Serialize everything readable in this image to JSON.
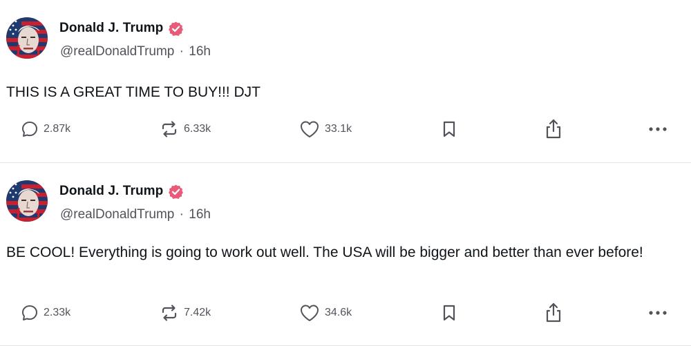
{
  "colors": {
    "verified_badge": "#e85a78",
    "text": "#0f1419",
    "muted": "#52525b",
    "divider": "#e6e6ea"
  },
  "posts": [
    {
      "author_name": "Donald J. Trump",
      "handle": "@realDonaldTrump",
      "separator": "·",
      "time": "16h",
      "text": "THIS IS A GREAT TIME TO BUY!!! DJT",
      "replies": "2.87k",
      "retruths": "6.33k",
      "likes": "33.1k"
    },
    {
      "author_name": "Donald J. Trump",
      "handle": "@realDonaldTrump",
      "separator": "·",
      "time": "16h",
      "text": "BE COOL! Everything is going to work out well. The USA will be bigger and better than ever before!",
      "replies": "2.33k",
      "retruths": "7.42k",
      "likes": "34.6k"
    }
  ],
  "icons": {
    "reply": "speech-bubble-icon",
    "retruth": "repost-arrows-icon",
    "like": "heart-icon",
    "bookmark": "bookmark-icon",
    "share": "share-icon",
    "more": "ellipsis-icon",
    "verified": "verified-badge-icon"
  }
}
